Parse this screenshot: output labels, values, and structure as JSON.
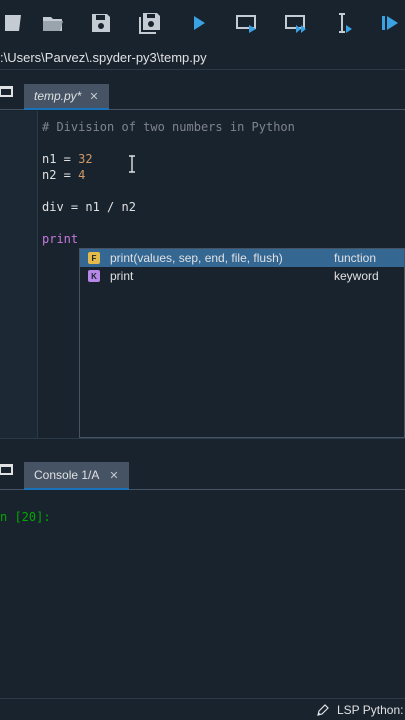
{
  "toolbar": {
    "buttons": [
      {
        "name": "new-file-icon"
      },
      {
        "name": "open-folder-icon"
      },
      {
        "name": "save-icon"
      },
      {
        "name": "save-all-icon"
      },
      {
        "name": "run-icon"
      },
      {
        "name": "run-cell-icon"
      },
      {
        "name": "run-cell-advance-icon"
      },
      {
        "name": "run-selection-icon"
      },
      {
        "name": "debug-icon"
      }
    ],
    "accent": "#1a72bb"
  },
  "path": ":\\Users\\Parvez\\.spyder-py3\\temp.py",
  "editor": {
    "tab_label": "temp.py*",
    "tab_close": "✕",
    "lines": [
      {
        "text": "# Division of two numbers in Python",
        "kind": "comment"
      },
      {
        "text": "",
        "kind": "blank"
      },
      {
        "var": "n1",
        "op": " = ",
        "num": "32",
        "kind": "assign"
      },
      {
        "var": "n2",
        "op": " = ",
        "num": "4",
        "kind": "assign"
      },
      {
        "text": "",
        "kind": "blank"
      },
      {
        "text": "div = n1 / n2",
        "kind": "plain"
      },
      {
        "text": "",
        "kind": "blank"
      },
      {
        "text": "print",
        "kind": "builtin"
      }
    ]
  },
  "completion": {
    "items": [
      {
        "badge": "F",
        "badge_color": "#e5b94a",
        "text": "print(values, sep, end, file, flush)",
        "kind": "function",
        "selected": true
      },
      {
        "badge": "K",
        "badge_color": "#b888e8",
        "text": "print",
        "kind": "keyword",
        "selected": false
      }
    ]
  },
  "console": {
    "tab_label": "Console 1/A",
    "tab_close": "✕",
    "prompt": "n [20]:"
  },
  "status": {
    "lsp": "LSP Python:"
  }
}
